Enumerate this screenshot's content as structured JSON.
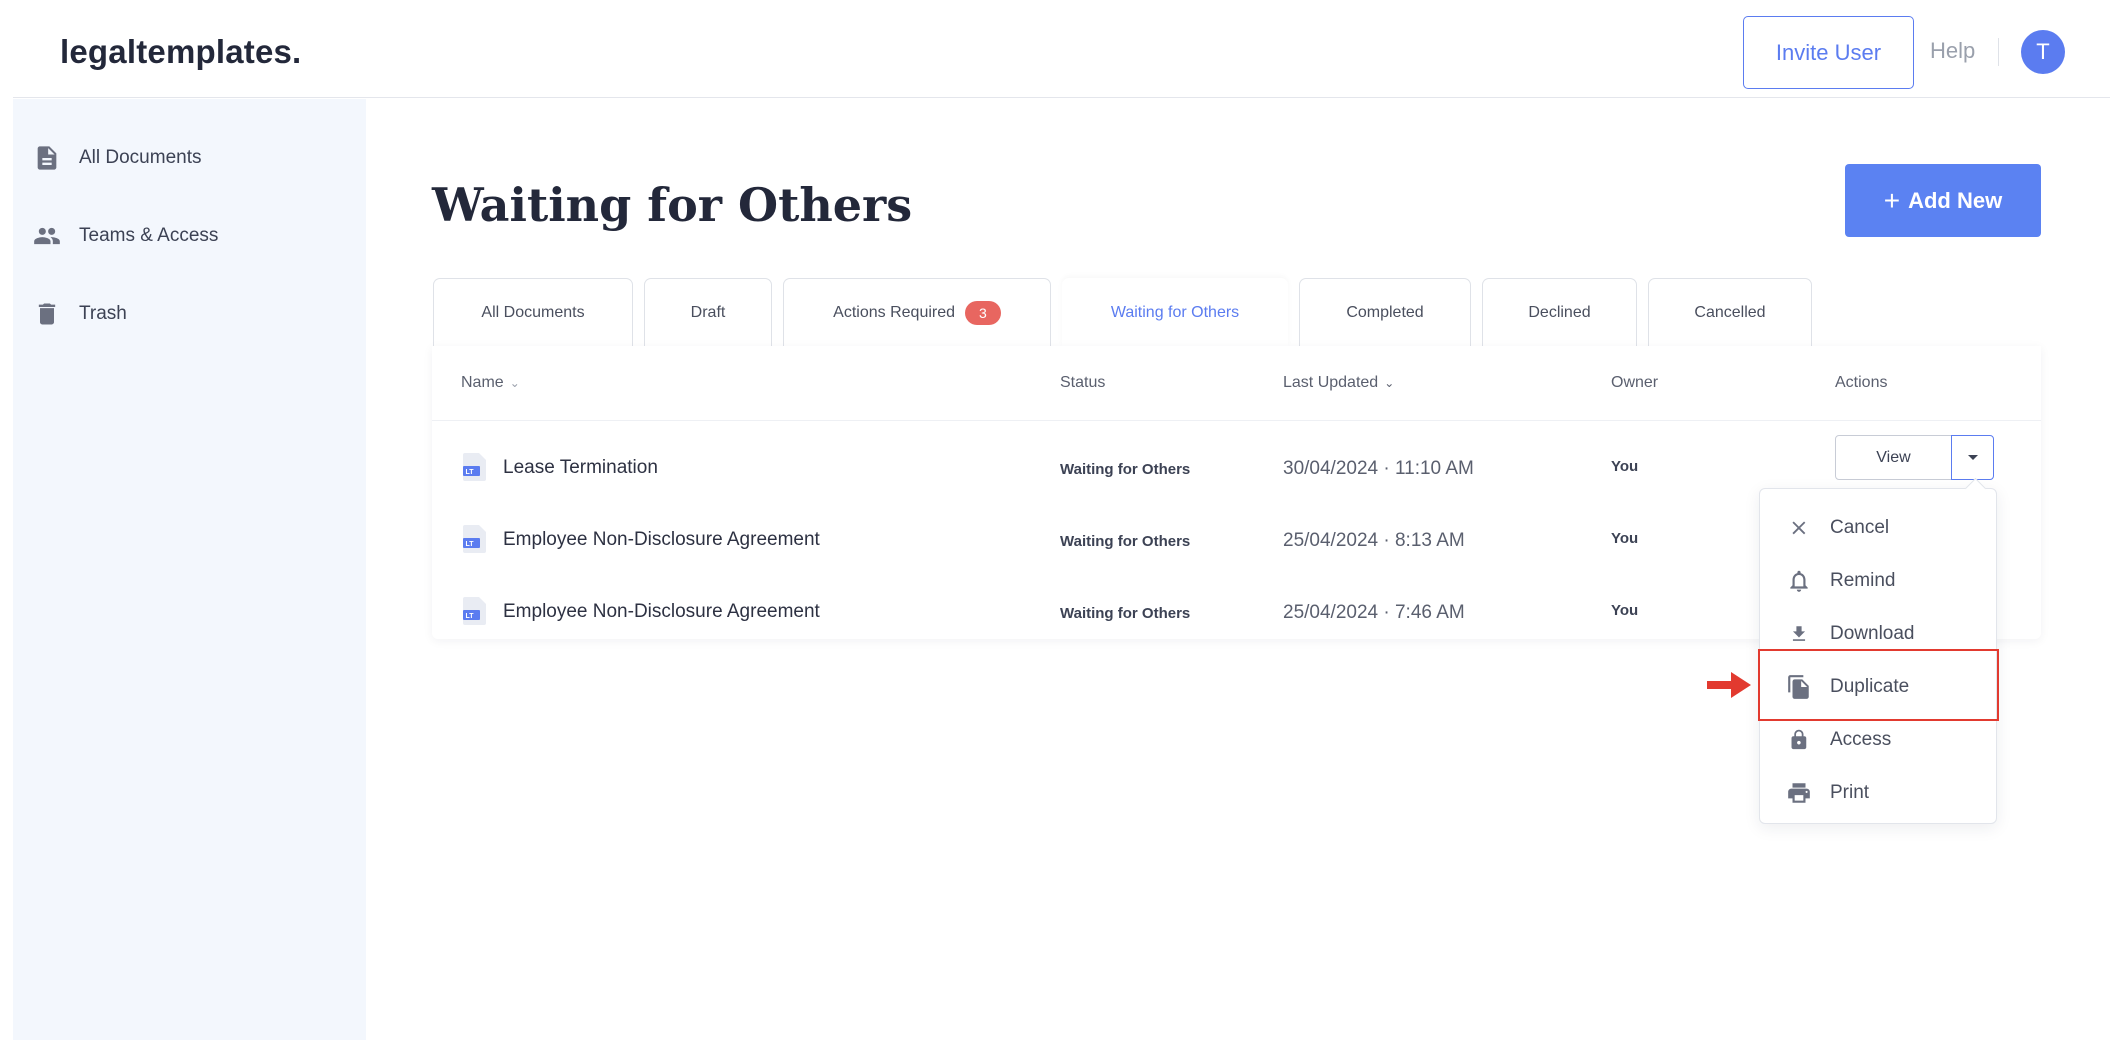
{
  "header": {
    "logo": "legaltemplates.",
    "invite_label": "Invite User",
    "help_label": "Help",
    "avatar_initial": "T"
  },
  "sidebar": {
    "items": [
      {
        "label": "All Documents",
        "icon": "document-icon"
      },
      {
        "label": "Teams & Access",
        "icon": "people-icon"
      },
      {
        "label": "Trash",
        "icon": "trash-icon"
      }
    ]
  },
  "main": {
    "title": "Waiting for Others",
    "add_label": "Add New",
    "tabs": [
      {
        "label": "All Documents"
      },
      {
        "label": "Draft"
      },
      {
        "label": "Actions Required",
        "badge": "3"
      },
      {
        "label": "Waiting for Others",
        "active": true
      },
      {
        "label": "Completed"
      },
      {
        "label": "Declined"
      },
      {
        "label": "Cancelled"
      }
    ],
    "columns": [
      "Name",
      "Status",
      "Last Updated",
      "Owner",
      "Actions"
    ],
    "rows": [
      {
        "name": "Lease Termination",
        "status": "Waiting for Others",
        "updated": "30/04/2024 · 11:10 AM",
        "owner": "You"
      },
      {
        "name": "Employee Non-Disclosure Agreement",
        "status": "Waiting for Others",
        "updated": "25/04/2024 · 8:13 AM",
        "owner": "You"
      },
      {
        "name": "Employee Non-Disclosure Agreement",
        "status": "Waiting for Others",
        "updated": "25/04/2024 · 7:46 AM",
        "owner": "You"
      }
    ],
    "view_label": "View",
    "doc_icon_text": "LT"
  },
  "dropdown": {
    "items": [
      {
        "label": "Cancel",
        "icon": "close-icon"
      },
      {
        "label": "Remind",
        "icon": "bell-icon"
      },
      {
        "label": "Download",
        "icon": "download-icon"
      },
      {
        "label": "Duplicate",
        "icon": "duplicate-icon"
      },
      {
        "label": "Access",
        "icon": "lock-icon"
      },
      {
        "label": "Print",
        "icon": "print-icon"
      }
    ]
  },
  "colors": {
    "accent": "#5b7cf0",
    "badge": "#e86660",
    "highlight": "#e23a2f"
  }
}
